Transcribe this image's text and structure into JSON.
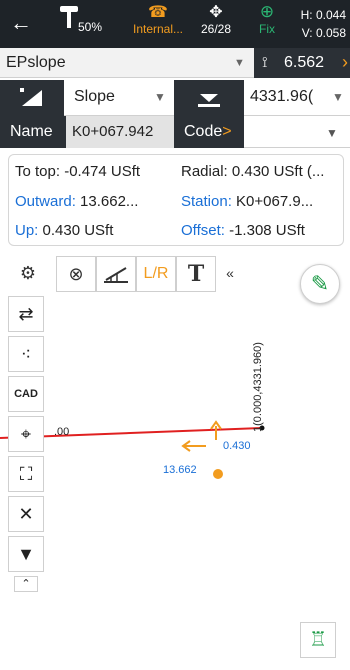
{
  "statusbar": {
    "back_icon": "back-arrow-icon",
    "battery_percent": "50%",
    "radio_label": "Internal...",
    "sats": "26/28",
    "fix_label": "Fix",
    "h_value": "H: 0.044",
    "v_value": "V: 0.058"
  },
  "project": {
    "name": "EPslope",
    "antenna_height": "6.562"
  },
  "mode": {
    "type_label": "Slope",
    "elevation_value": "4331.96("
  },
  "point": {
    "name_label": "Name",
    "name_value": "K0+067.942",
    "code_label": "Code",
    "code_arrow": ">",
    "code_value": ""
  },
  "info": {
    "to_top": "To top: -0.474 USft",
    "radial": "Radial: 0.430 USft (...",
    "outward_label": "Outward:",
    "outward_value": "13.662...",
    "station_label": "Station:",
    "station_value": "K0+067.9...",
    "up_label": "Up:",
    "up_value": "0.430 USft",
    "offset_label": "Offset:",
    "offset_value": "-1.308 USft"
  },
  "toolbar": {
    "lr_label": "L/R",
    "text_label": "T",
    "collapse_label": "«"
  },
  "map": {
    "point_label": "1(0.000,4331.960)",
    "up_value": "0.430",
    "outward_value": "13.662",
    "edge_label": ".00",
    "line_color": "#e02020",
    "arrow_color": "#f29c1f",
    "value_color": "#1a6fd6"
  },
  "colors": {
    "accent": "#f29c1f",
    "header_dark": "#1e2328",
    "fix_green": "#2bb673"
  }
}
